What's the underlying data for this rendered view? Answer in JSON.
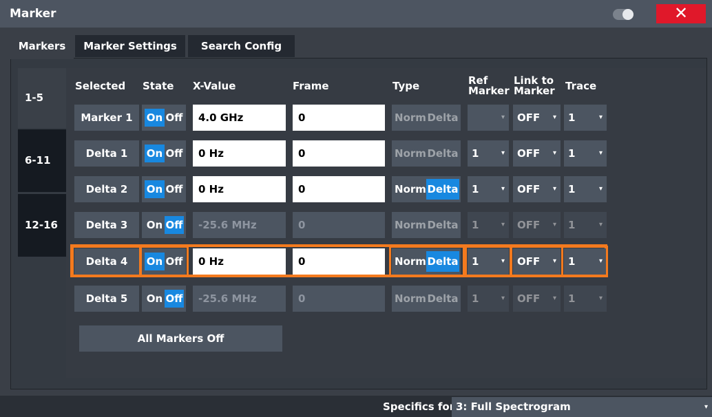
{
  "window": {
    "title": "Marker",
    "close_label": "✕"
  },
  "tabs": [
    {
      "label": "Markers",
      "active": true
    },
    {
      "label": "Marker Settings",
      "active": false
    },
    {
      "label": "Search Config",
      "active": false
    }
  ],
  "groups": [
    {
      "label": "1-5",
      "active": true
    },
    {
      "label": "6-11",
      "active": false
    },
    {
      "label": "12-16",
      "active": false
    }
  ],
  "headers": {
    "selected": "Selected",
    "state": "State",
    "x_value": "X-Value",
    "frame": "Frame",
    "type": "Type",
    "ref_marker_1": "Ref",
    "ref_marker_2": "Marker",
    "link_1": "Link to",
    "link_2": "Marker",
    "trace": "Trace"
  },
  "on_label": "On",
  "off_label": "Off",
  "norm_label": "Norm",
  "delta_label": "Delta",
  "dropdown_arrow": "▾",
  "markers": [
    {
      "name": "Marker 1",
      "state": "On",
      "x_value": "4.0 GHz",
      "frame": "0",
      "type": "",
      "ref_marker": "",
      "link": "OFF",
      "trace": "1",
      "enabled": true,
      "selected": false
    },
    {
      "name": "Delta 1",
      "state": "On",
      "x_value": "0 Hz",
      "frame": "0",
      "type": "",
      "ref_marker": "1",
      "link": "OFF",
      "trace": "1",
      "enabled": true,
      "selected": false
    },
    {
      "name": "Delta 2",
      "state": "On",
      "x_value": "0 Hz",
      "frame": "0",
      "type": "Delta",
      "ref_marker": "1",
      "link": "OFF",
      "trace": "1",
      "enabled": true,
      "selected": false
    },
    {
      "name": "Delta 3",
      "state": "Off",
      "x_value": "-25.6 MHz",
      "frame": "0",
      "type": "",
      "ref_marker": "1",
      "link": "OFF",
      "trace": "1",
      "enabled": false,
      "selected": false
    },
    {
      "name": "Delta 4",
      "state": "On",
      "x_value": "0 Hz",
      "frame": "0",
      "type": "Delta",
      "ref_marker": "1",
      "link": "OFF",
      "trace": "1",
      "enabled": true,
      "selected": true
    },
    {
      "name": "Delta 5",
      "state": "Off",
      "x_value": "-25.6 MHz",
      "frame": "0",
      "type": "",
      "ref_marker": "1",
      "link": "OFF",
      "trace": "1",
      "enabled": false,
      "selected": false
    }
  ],
  "all_markers_off": "All Markers Off",
  "specifics": {
    "label": "Specifics for",
    "value": "3: Full Spectrogram"
  },
  "colors": {
    "accent": "#1888e0",
    "highlight": "#f47a1e",
    "close": "#e0182a"
  }
}
